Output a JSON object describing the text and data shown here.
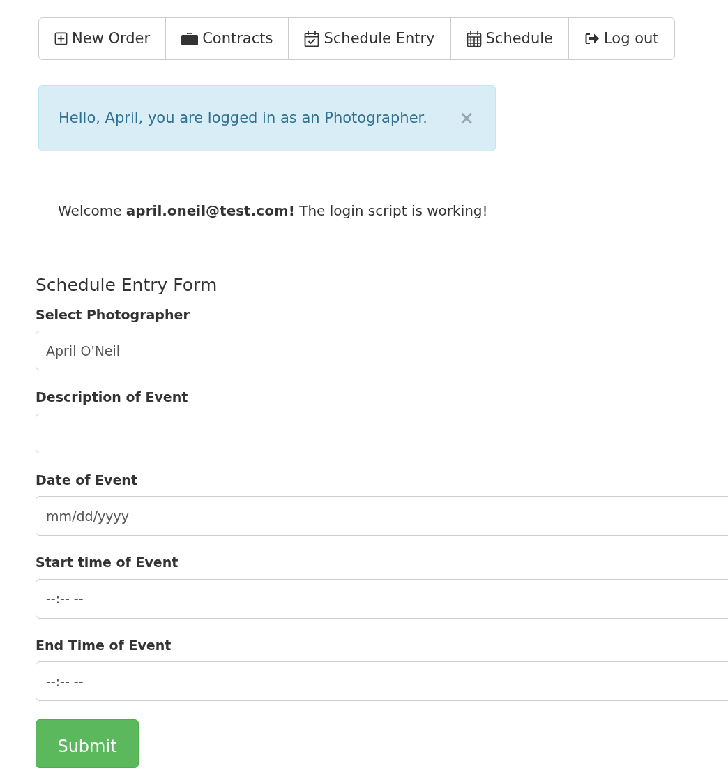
{
  "nav": [
    {
      "label": "New Order",
      "kind": "plus"
    },
    {
      "label": "Contracts",
      "kind": "briefcase"
    },
    {
      "label": "Schedule Entry",
      "kind": "calendar-check"
    },
    {
      "label": "Schedule",
      "kind": "calendar"
    },
    {
      "label": "Log out",
      "kind": "logout"
    }
  ],
  "alert": {
    "text": "Hello, April, you are logged in as an Photographer.",
    "close": "×"
  },
  "welcome": "Welcome **april.oneil@test.com!** The login script is working!",
  "form": {
    "title": "Schedule Entry Form",
    "fields": [
      {
        "label": "Select Photographer",
        "value": "April O'Neil"
      },
      {
        "label": "Description of Event"
      },
      {
        "label": "Date of Event",
        "placeholder": "mm/dd/yyyy"
      },
      {
        "label": "Start time of Event",
        "placeholder": "--:-- --"
      },
      {
        "label": "End Time of Event",
        "placeholder": "--:-- --"
      }
    ],
    "submit": "Submit"
  }
}
